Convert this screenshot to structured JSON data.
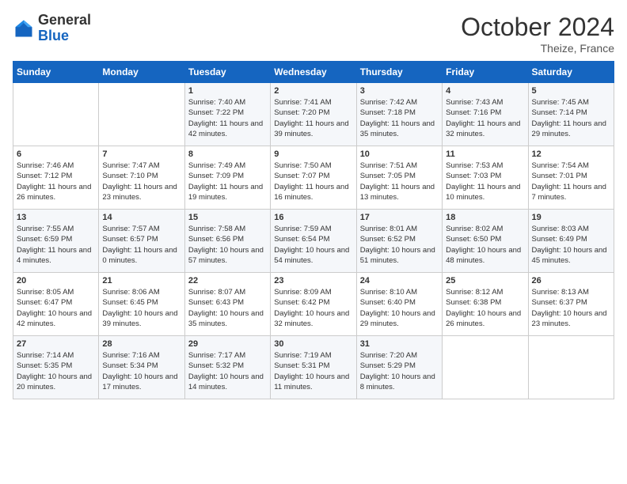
{
  "logo": {
    "general": "General",
    "blue": "Blue"
  },
  "header": {
    "month": "October 2024",
    "location": "Theize, France"
  },
  "weekdays": [
    "Sunday",
    "Monday",
    "Tuesday",
    "Wednesday",
    "Thursday",
    "Friday",
    "Saturday"
  ],
  "weeks": [
    [
      {
        "day": "",
        "sunrise": "",
        "sunset": "",
        "daylight": ""
      },
      {
        "day": "",
        "sunrise": "",
        "sunset": "",
        "daylight": ""
      },
      {
        "day": "1",
        "sunrise": "Sunrise: 7:40 AM",
        "sunset": "Sunset: 7:22 PM",
        "daylight": "Daylight: 11 hours and 42 minutes."
      },
      {
        "day": "2",
        "sunrise": "Sunrise: 7:41 AM",
        "sunset": "Sunset: 7:20 PM",
        "daylight": "Daylight: 11 hours and 39 minutes."
      },
      {
        "day": "3",
        "sunrise": "Sunrise: 7:42 AM",
        "sunset": "Sunset: 7:18 PM",
        "daylight": "Daylight: 11 hours and 35 minutes."
      },
      {
        "day": "4",
        "sunrise": "Sunrise: 7:43 AM",
        "sunset": "Sunset: 7:16 PM",
        "daylight": "Daylight: 11 hours and 32 minutes."
      },
      {
        "day": "5",
        "sunrise": "Sunrise: 7:45 AM",
        "sunset": "Sunset: 7:14 PM",
        "daylight": "Daylight: 11 hours and 29 minutes."
      }
    ],
    [
      {
        "day": "6",
        "sunrise": "Sunrise: 7:46 AM",
        "sunset": "Sunset: 7:12 PM",
        "daylight": "Daylight: 11 hours and 26 minutes."
      },
      {
        "day": "7",
        "sunrise": "Sunrise: 7:47 AM",
        "sunset": "Sunset: 7:10 PM",
        "daylight": "Daylight: 11 hours and 23 minutes."
      },
      {
        "day": "8",
        "sunrise": "Sunrise: 7:49 AM",
        "sunset": "Sunset: 7:09 PM",
        "daylight": "Daylight: 11 hours and 19 minutes."
      },
      {
        "day": "9",
        "sunrise": "Sunrise: 7:50 AM",
        "sunset": "Sunset: 7:07 PM",
        "daylight": "Daylight: 11 hours and 16 minutes."
      },
      {
        "day": "10",
        "sunrise": "Sunrise: 7:51 AM",
        "sunset": "Sunset: 7:05 PM",
        "daylight": "Daylight: 11 hours and 13 minutes."
      },
      {
        "day": "11",
        "sunrise": "Sunrise: 7:53 AM",
        "sunset": "Sunset: 7:03 PM",
        "daylight": "Daylight: 11 hours and 10 minutes."
      },
      {
        "day": "12",
        "sunrise": "Sunrise: 7:54 AM",
        "sunset": "Sunset: 7:01 PM",
        "daylight": "Daylight: 11 hours and 7 minutes."
      }
    ],
    [
      {
        "day": "13",
        "sunrise": "Sunrise: 7:55 AM",
        "sunset": "Sunset: 6:59 PM",
        "daylight": "Daylight: 11 hours and 4 minutes."
      },
      {
        "day": "14",
        "sunrise": "Sunrise: 7:57 AM",
        "sunset": "Sunset: 6:57 PM",
        "daylight": "Daylight: 11 hours and 0 minutes."
      },
      {
        "day": "15",
        "sunrise": "Sunrise: 7:58 AM",
        "sunset": "Sunset: 6:56 PM",
        "daylight": "Daylight: 10 hours and 57 minutes."
      },
      {
        "day": "16",
        "sunrise": "Sunrise: 7:59 AM",
        "sunset": "Sunset: 6:54 PM",
        "daylight": "Daylight: 10 hours and 54 minutes."
      },
      {
        "day": "17",
        "sunrise": "Sunrise: 8:01 AM",
        "sunset": "Sunset: 6:52 PM",
        "daylight": "Daylight: 10 hours and 51 minutes."
      },
      {
        "day": "18",
        "sunrise": "Sunrise: 8:02 AM",
        "sunset": "Sunset: 6:50 PM",
        "daylight": "Daylight: 10 hours and 48 minutes."
      },
      {
        "day": "19",
        "sunrise": "Sunrise: 8:03 AM",
        "sunset": "Sunset: 6:49 PM",
        "daylight": "Daylight: 10 hours and 45 minutes."
      }
    ],
    [
      {
        "day": "20",
        "sunrise": "Sunrise: 8:05 AM",
        "sunset": "Sunset: 6:47 PM",
        "daylight": "Daylight: 10 hours and 42 minutes."
      },
      {
        "day": "21",
        "sunrise": "Sunrise: 8:06 AM",
        "sunset": "Sunset: 6:45 PM",
        "daylight": "Daylight: 10 hours and 39 minutes."
      },
      {
        "day": "22",
        "sunrise": "Sunrise: 8:07 AM",
        "sunset": "Sunset: 6:43 PM",
        "daylight": "Daylight: 10 hours and 35 minutes."
      },
      {
        "day": "23",
        "sunrise": "Sunrise: 8:09 AM",
        "sunset": "Sunset: 6:42 PM",
        "daylight": "Daylight: 10 hours and 32 minutes."
      },
      {
        "day": "24",
        "sunrise": "Sunrise: 8:10 AM",
        "sunset": "Sunset: 6:40 PM",
        "daylight": "Daylight: 10 hours and 29 minutes."
      },
      {
        "day": "25",
        "sunrise": "Sunrise: 8:12 AM",
        "sunset": "Sunset: 6:38 PM",
        "daylight": "Daylight: 10 hours and 26 minutes."
      },
      {
        "day": "26",
        "sunrise": "Sunrise: 8:13 AM",
        "sunset": "Sunset: 6:37 PM",
        "daylight": "Daylight: 10 hours and 23 minutes."
      }
    ],
    [
      {
        "day": "27",
        "sunrise": "Sunrise: 7:14 AM",
        "sunset": "Sunset: 5:35 PM",
        "daylight": "Daylight: 10 hours and 20 minutes."
      },
      {
        "day": "28",
        "sunrise": "Sunrise: 7:16 AM",
        "sunset": "Sunset: 5:34 PM",
        "daylight": "Daylight: 10 hours and 17 minutes."
      },
      {
        "day": "29",
        "sunrise": "Sunrise: 7:17 AM",
        "sunset": "Sunset: 5:32 PM",
        "daylight": "Daylight: 10 hours and 14 minutes."
      },
      {
        "day": "30",
        "sunrise": "Sunrise: 7:19 AM",
        "sunset": "Sunset: 5:31 PM",
        "daylight": "Daylight: 10 hours and 11 minutes."
      },
      {
        "day": "31",
        "sunrise": "Sunrise: 7:20 AM",
        "sunset": "Sunset: 5:29 PM",
        "daylight": "Daylight: 10 hours and 8 minutes."
      },
      {
        "day": "",
        "sunrise": "",
        "sunset": "",
        "daylight": ""
      },
      {
        "day": "",
        "sunrise": "",
        "sunset": "",
        "daylight": ""
      }
    ]
  ]
}
